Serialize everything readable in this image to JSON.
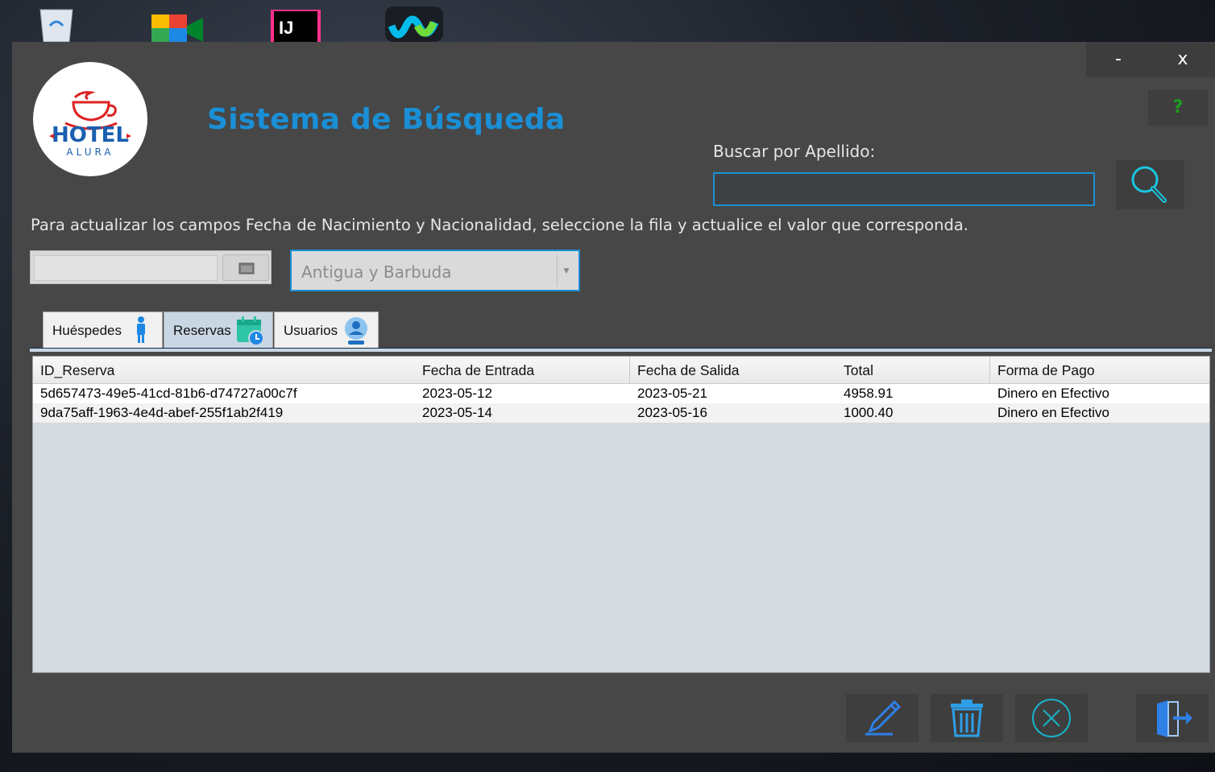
{
  "desktop": {
    "icons": [
      "recycle-bin-icon",
      "google-meet-icon",
      "intellij-idea-icon",
      "webex-icon"
    ],
    "intellij_text": "IJ"
  },
  "window": {
    "minimize_label": "-",
    "close_label": "x",
    "help_label": "?"
  },
  "logo": {
    "line1": "HOTEL",
    "line2": "ALURA"
  },
  "header": {
    "title": "Sistema de Búsqueda"
  },
  "search": {
    "label": "Buscar por Apellido:",
    "value": "",
    "placeholder": ""
  },
  "hint": "Para actualizar los campos Fecha de Nacimiento y Nacionalidad, seleccione la fila y actualice el valor que corresponda.",
  "birthdate": {
    "value": ""
  },
  "nationality": {
    "selected": "Antigua y Barbuda"
  },
  "tabs": [
    {
      "label": "Huéspedes",
      "icon": "person-icon",
      "active": false
    },
    {
      "label": "Reservas",
      "icon": "calendar-clock-icon",
      "active": true
    },
    {
      "label": "Usuarios",
      "icon": "user-badge-icon",
      "active": false
    }
  ],
  "table": {
    "columns": [
      "ID_Reserva",
      "Fecha de Entrada",
      "Fecha de Salida",
      "Total",
      "Forma de Pago"
    ],
    "rows": [
      [
        "5d657473-49e5-41cd-81b6-d74727a00c7f",
        "2023-05-12",
        "2023-05-21",
        "4958.91",
        "Dinero en Efectivo"
      ],
      [
        "9da75aff-1963-4e4d-abef-255f1ab2f419",
        "2023-05-14",
        "2023-05-16",
        "1000.40",
        "Dinero en Efectivo"
      ]
    ]
  },
  "actions": [
    "edit-icon",
    "delete-icon",
    "cancel-icon",
    "exit-icon"
  ],
  "colors": {
    "accent": "#1a8fd6",
    "window_bg": "#474747",
    "selected_row": "#d6dae1",
    "help_green": "#1e9e1e"
  }
}
